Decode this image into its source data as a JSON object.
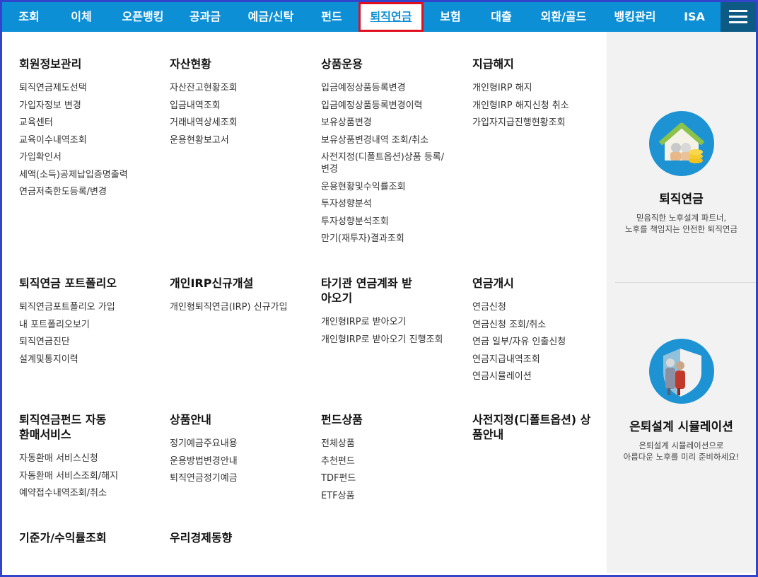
{
  "nav": {
    "items": [
      "조회",
      "이체",
      "오픈뱅킹",
      "공과금",
      "예금/신탁",
      "펀드",
      "퇴직연금",
      "보험",
      "대출",
      "외환/골드",
      "뱅킹관리",
      "ISA"
    ],
    "active_index": 6
  },
  "sections": [
    {
      "heading": "회원정보관리",
      "links": [
        "퇴직연금제도선택",
        "가입자정보 변경",
        "교육센터",
        "교육이수내역조회",
        "가입확인서",
        "세액(소득)공제납입증명출력",
        "연금저축한도등록/변경"
      ]
    },
    {
      "heading": "자산현황",
      "links": [
        "자산잔고현황조회",
        "입금내역조회",
        "거래내역상세조회",
        "운용현황보고서"
      ]
    },
    {
      "heading": "상품운용",
      "links": [
        "입금예정상품등록변경",
        "입금예정상품등록변경이력",
        "보유상품변경",
        "보유상품변경내역 조회/취소",
        "사전지정(디폴트옵션)상품 등록/변경",
        "운용현황및수익률조회",
        "투자성향분석",
        "투자성향분석조회",
        "만기(재투자)결과조회"
      ]
    },
    {
      "heading": "지급해지",
      "links": [
        "개인형IRP 해지",
        "개인형IRP 해지신청 취소",
        "가입자지급진행현황조회"
      ]
    },
    {
      "heading": "퇴직연금 포트폴리오",
      "links": [
        "퇴직연금포트폴리오 가입",
        "내 포트폴리오보기",
        "퇴직연금진단",
        "설계및통지이력"
      ]
    },
    {
      "heading": "개인IRP신규개설",
      "links": [
        "개인형퇴직연금(IRP) 신규가입"
      ]
    },
    {
      "heading": "타기관 연금계좌 받아오기",
      "links": [
        "개인형IRP로 받아오기",
        "개인형IRP로 받아오기 진행조회"
      ]
    },
    {
      "heading": "연금개시",
      "links": [
        "연금신청",
        "연금신청 조회/취소",
        "연금 일부/자유 인출신청",
        "연금지급내역조회",
        "연금시뮬레이션"
      ]
    },
    {
      "heading": "퇴직연금펀드 자동환매서비스",
      "links": [
        "자동환매 서비스신청",
        "자동환매 서비스조회/해지",
        "예약접수내역조회/취소"
      ]
    },
    {
      "heading": "상품안내",
      "links": [
        "정기예금주요내용",
        "운용방법변경안내",
        "퇴직연금정기예금"
      ]
    },
    {
      "heading": "펀드상품",
      "links": [
        "전체상품",
        "추천펀드",
        "TDF펀드",
        "ETF상품"
      ]
    },
    {
      "heading": "사전지정(디폴트옵션) 상품안내",
      "links": []
    },
    {
      "heading": "기준가/수익률조회",
      "links": []
    },
    {
      "heading": "우리경제동향",
      "links": []
    }
  ],
  "promos": [
    {
      "icon": "retirement-house-icon",
      "title": "퇴직연금",
      "desc1": "믿음직한 노후설계 파트너,",
      "desc2": "노후를 책임지는 안전한 퇴직연금"
    },
    {
      "icon": "retirement-couple-shield-icon",
      "title": "은퇴설계 시뮬레이션",
      "desc1": "은퇴설계 시뮬레이션으로",
      "desc2": "아름다운 노후를 미리 준비하세요!"
    }
  ],
  "colors": {
    "nav_bg": "#0d8fd6",
    "nav_active_border": "#e0101e",
    "hamburger_bg": "#0d5a84",
    "frame": "#3344cc"
  }
}
